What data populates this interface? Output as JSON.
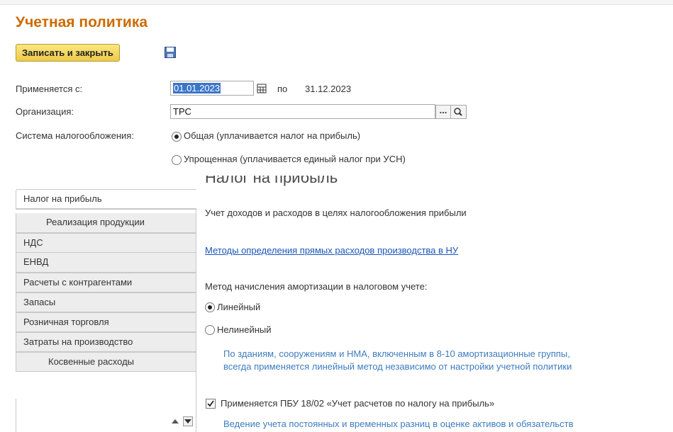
{
  "window": {
    "title": "Учетная политика"
  },
  "toolbar": {
    "save_close_label": "Записать и закрыть",
    "save_icon": "floppy-disk-icon"
  },
  "form": {
    "applies_from_label": "Применяется с:",
    "applies_from_value": "01.01.2023",
    "to_label": "по",
    "to_value": "31.12.2023",
    "organization_label": "Организация:",
    "organization_value": "ТРС",
    "tax_system_label": "Система налогообложения:",
    "tax_options": [
      {
        "label": "Общая (уплачивается налог на прибыль)",
        "selected": true
      },
      {
        "label": "Упрощенная (уплачивается единый налог при УСН)",
        "selected": false
      }
    ]
  },
  "sidebar": {
    "items": [
      {
        "label": "Налог на прибыль",
        "active": true
      },
      {
        "label": "Реализация продукции"
      },
      {
        "label": "НДС"
      },
      {
        "label": "ЕНВД"
      },
      {
        "label": "Расчеты с контрагентами"
      },
      {
        "label": "Запасы"
      },
      {
        "label": "Розничная торговля"
      },
      {
        "label": "Затраты на производство"
      },
      {
        "label": "Косвенные расходы"
      }
    ]
  },
  "panel": {
    "heading": "Налог на прибыль",
    "subtitle": "Учет доходов и расходов в целях налогообложения прибыли",
    "link_direct_costs": "Методы определения прямых расходов производства в НУ",
    "amort_label": "Метод начисления амортизации в налоговом учете:",
    "amort_options": [
      {
        "label": "Линейный",
        "selected": true
      },
      {
        "label": "Нелинейный",
        "selected": false
      }
    ],
    "amort_note_1": "По зданиям, сооружениям и НМА, включенным в 8-10 амортизационные группы,",
    "amort_note_2": "всегда применяется линейный метод независимо от настройки учетной политики",
    "pbu_label": "Применяется ПБУ 18/02 «Учет расчетов по налогу на прибыль»",
    "pbu_checked": true,
    "pbu_note": "Ведение учета постоянных и временных разниц в оценке активов и обязательств"
  },
  "colors": {
    "accent": "#cc6a00",
    "link": "#1a55b8",
    "note": "#3e7cbf",
    "button": "#eec94a"
  }
}
